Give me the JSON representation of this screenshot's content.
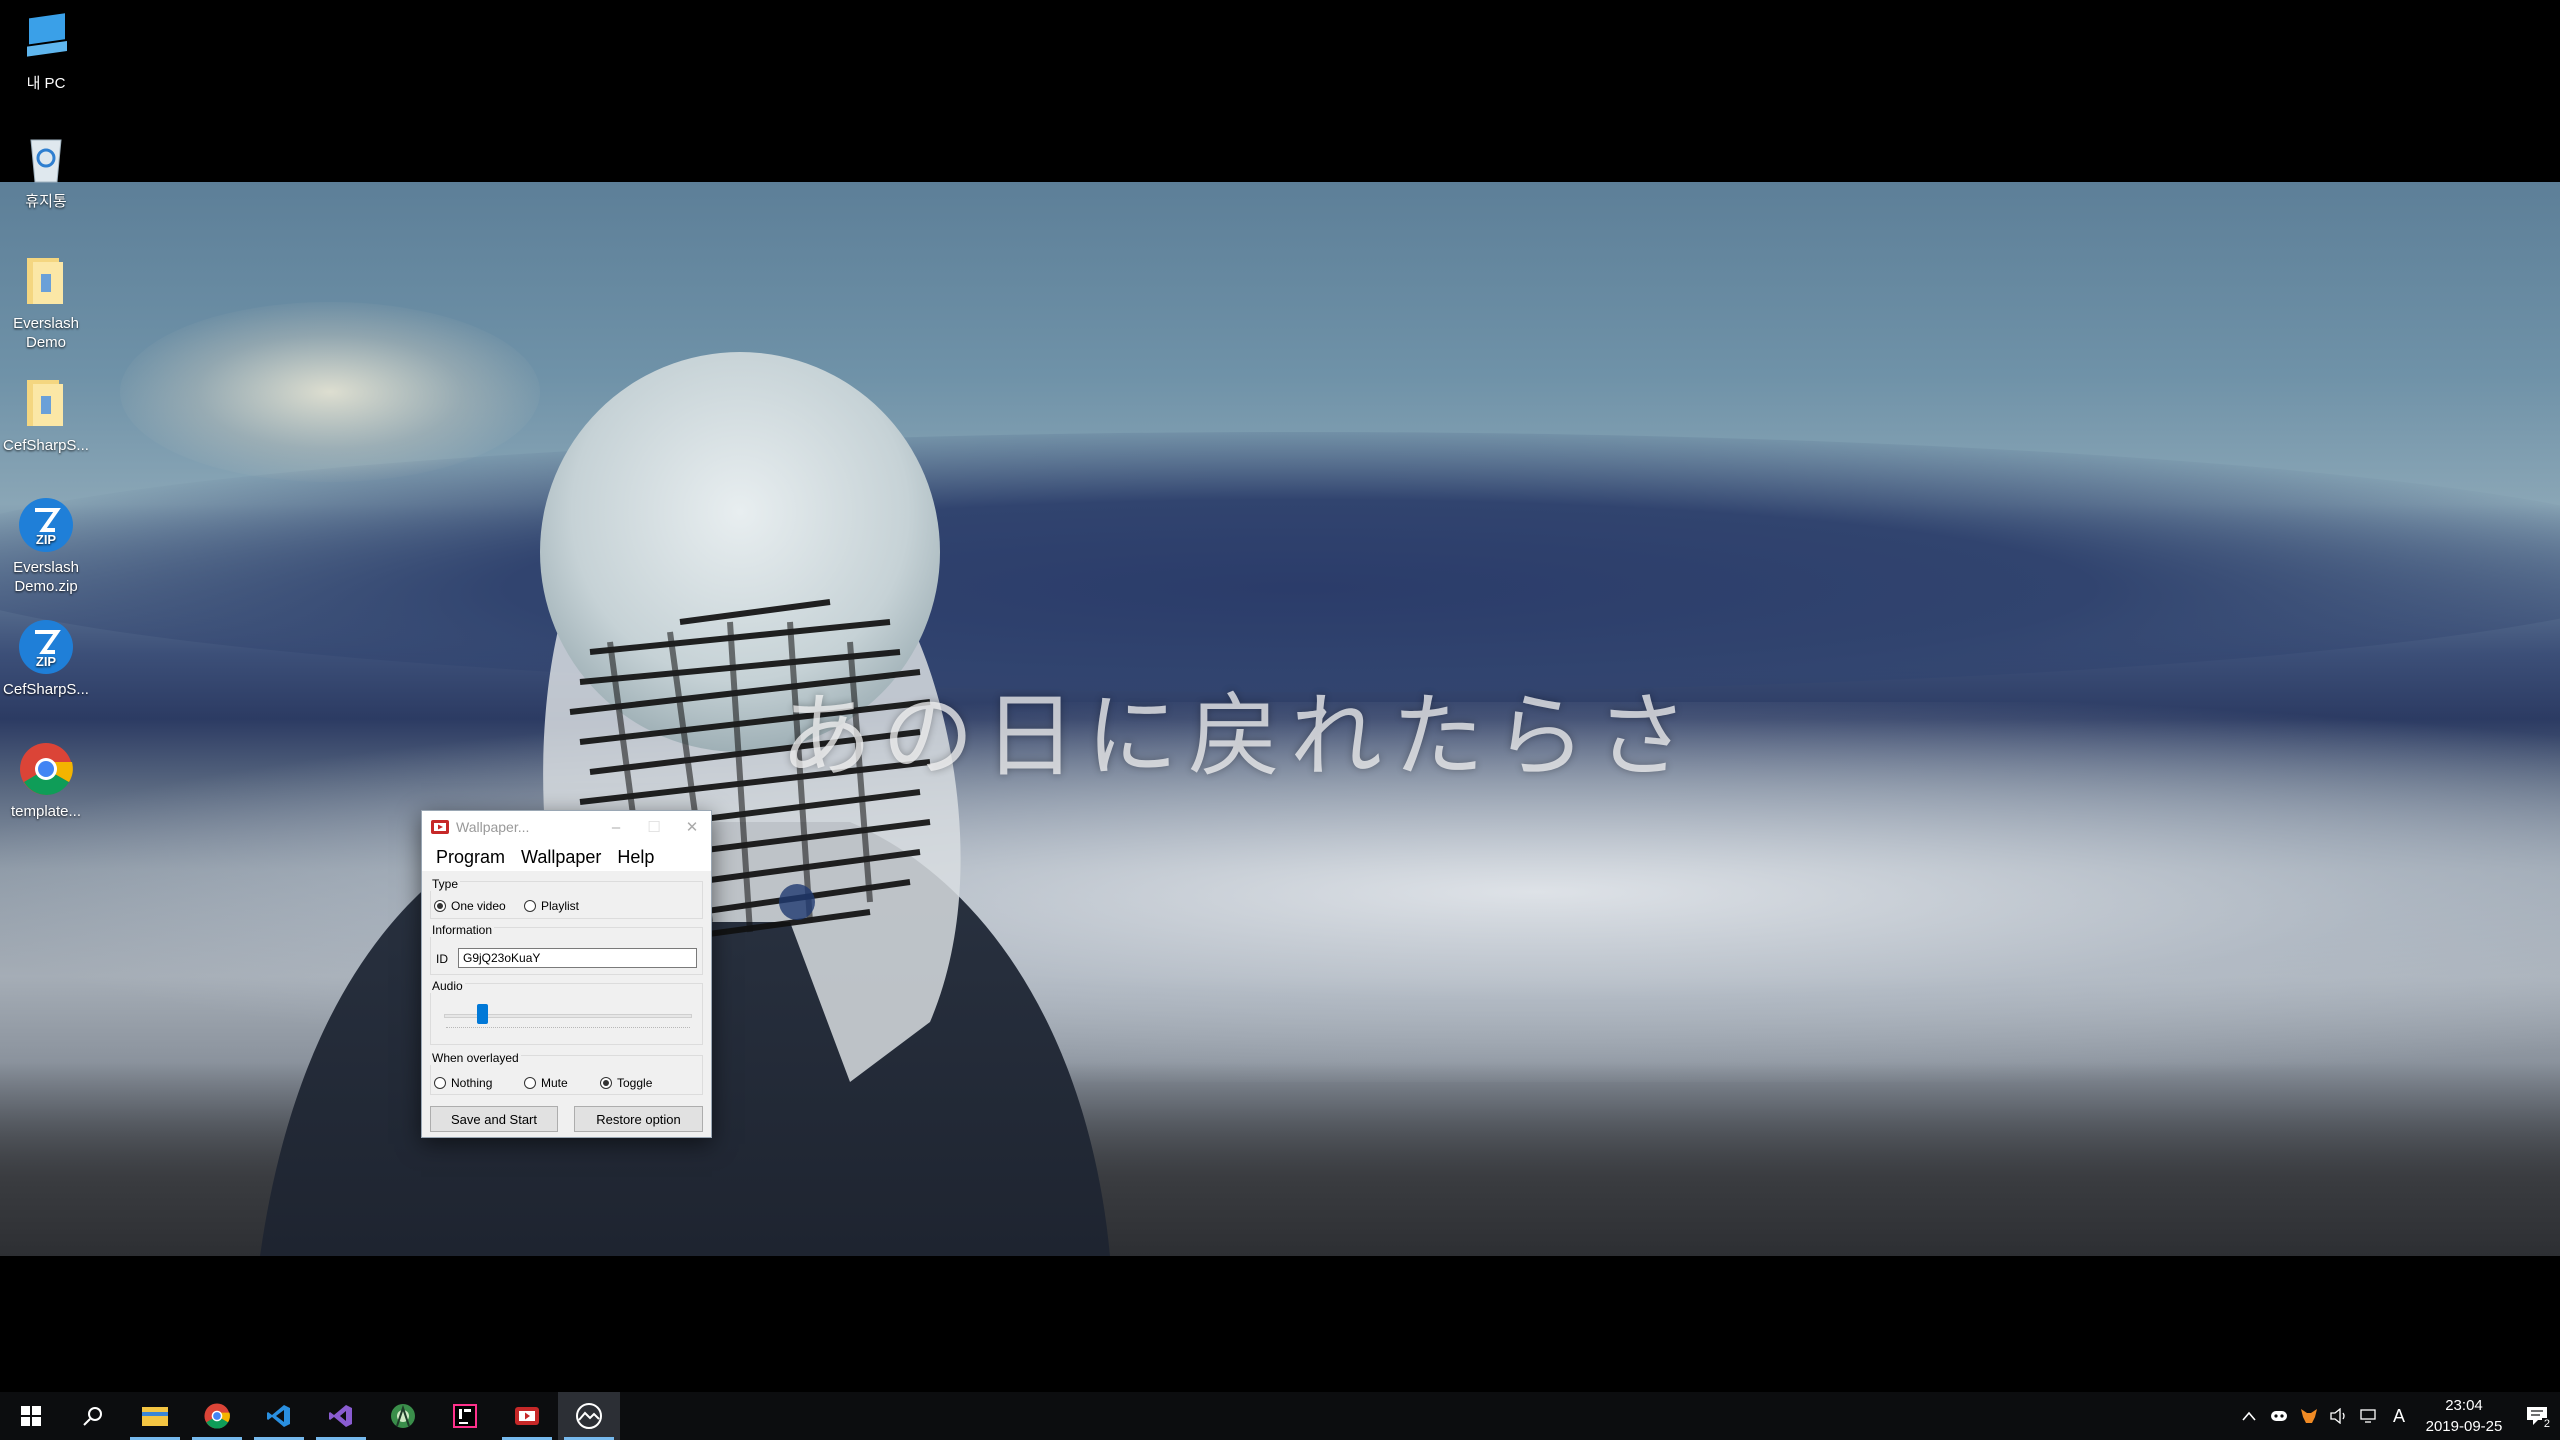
{
  "desktop_icons": [
    {
      "label": "내 PC",
      "icon": "this-pc-icon"
    },
    {
      "label": "휴지통",
      "icon": "recycle-bin-icon"
    },
    {
      "label": "Everslash Demo",
      "icon": "folder-icon"
    },
    {
      "label": "CefSharpS...",
      "icon": "folder-icon"
    },
    {
      "label": "Everslash Demo.zip",
      "icon": "zip-archive-icon"
    },
    {
      "label": "CefSharpS...",
      "icon": "zip-archive-icon"
    },
    {
      "label": "template...",
      "icon": "chrome-icon"
    }
  ],
  "wallpaper": {
    "lyric_text": "あの日に戻れたらさ"
  },
  "window": {
    "title": "Wallpaper...",
    "controls": {
      "minimize": "–",
      "maximize": "☐",
      "close": "✕"
    },
    "menu": [
      "Program",
      "Wallpaper",
      "Help"
    ],
    "type_group": {
      "title": "Type",
      "options": [
        {
          "label": "One video",
          "selected": true
        },
        {
          "label": "Playlist",
          "selected": false
        }
      ]
    },
    "information_group": {
      "title": "Information",
      "id_label": "ID",
      "id_value": "G9jQ23oKuaY"
    },
    "audio_group": {
      "title": "Audio",
      "volume_fraction": 0.14
    },
    "overlay_group": {
      "title": "When overlayed",
      "options": [
        {
          "label": "Nothing",
          "selected": false
        },
        {
          "label": "Mute",
          "selected": false
        },
        {
          "label": "Toggle",
          "selected": true
        }
      ]
    },
    "buttons": {
      "save_start": "Save and Start",
      "restore": "Restore option"
    }
  },
  "taskbar": {
    "apps": [
      "start-icon",
      "search-icon",
      "file-explorer-icon",
      "chrome-icon",
      "vscode-icon",
      "visual-studio-icon",
      "android-studio-icon",
      "intellij-icon",
      "wallpaper-app-icon",
      "wallpaper-engine-icon"
    ],
    "tray": {
      "ime_label": "A",
      "time": "23:04",
      "date": "2019-09-25",
      "notification_count": "2"
    }
  },
  "colors": {
    "accent": "#0078d7",
    "taskbar_bg": "#0c0d0f",
    "window_bg": "#f0f0f0"
  }
}
